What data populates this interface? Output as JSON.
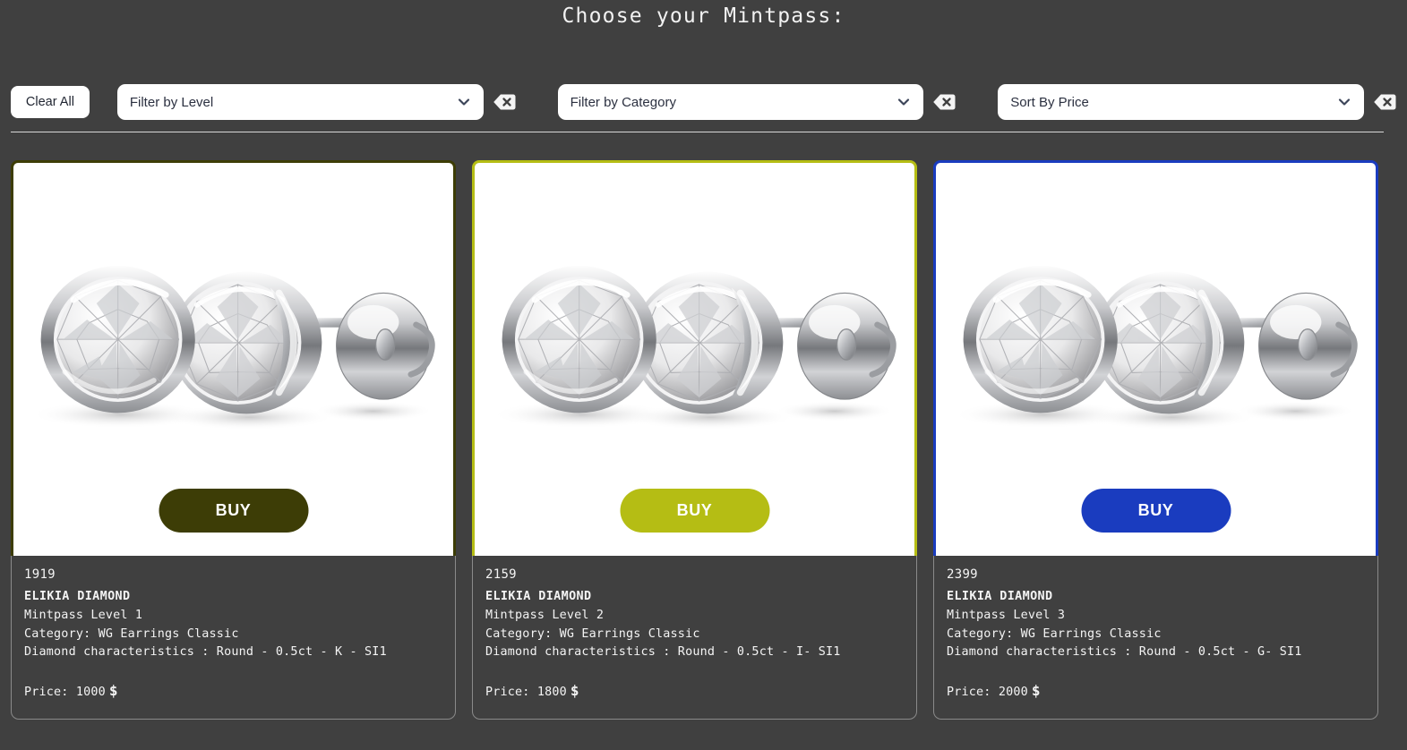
{
  "header": {
    "title": "Choose your Mintpass:"
  },
  "filters": {
    "clear_all_label": "Clear All",
    "controls": [
      {
        "name": "filter-by-level",
        "label": "Filter by Level",
        "clear_icon": "backspace-clear-icon"
      },
      {
        "name": "filter-by-category",
        "label": "Filter by Category",
        "clear_icon": "backspace-clear-icon"
      },
      {
        "name": "sort-by-price",
        "label": "Sort By Price",
        "clear_icon": "backspace-clear-icon"
      }
    ],
    "chevron_icon": "chevron-down-icon",
    "chevron_color": "#3c4559"
  },
  "cards": [
    {
      "token_id": "1919",
      "brand": "ELIKIA DIAMOND",
      "level": "Mintpass Level 1",
      "category": "Category: WG Earrings Classic",
      "characteristics": "Diamond characteristics : Round - 0.5ct - K - SI1",
      "price": "Price: 1000",
      "currency": "$",
      "buy_label": "BUY",
      "accent": "#3d3d06"
    },
    {
      "token_id": "2159",
      "brand": "ELIKIA DIAMOND",
      "level": "Mintpass Level 2",
      "category": "Category: WG Earrings Classic",
      "characteristics": "Diamond characteristics : Round - 0.5ct - I- SI1",
      "price": "Price: 1800",
      "currency": "$",
      "buy_label": "BUY",
      "accent": "#b5bd14"
    },
    {
      "token_id": "2399",
      "brand": "ELIKIA DIAMOND",
      "level": "Mintpass Level 3",
      "category": "Category: WG Earrings Classic",
      "characteristics": "Diamond characteristics : Round - 0.5ct - G- SI1",
      "price": "Price: 2000",
      "currency": "$",
      "buy_label": "BUY",
      "accent": "#1a3cbf"
    }
  ],
  "product_image": {
    "alt": "diamond-stud-earrings"
  },
  "theme": {
    "background": "#404040",
    "panel": "#ffffff",
    "text": "#f4f4f4"
  }
}
